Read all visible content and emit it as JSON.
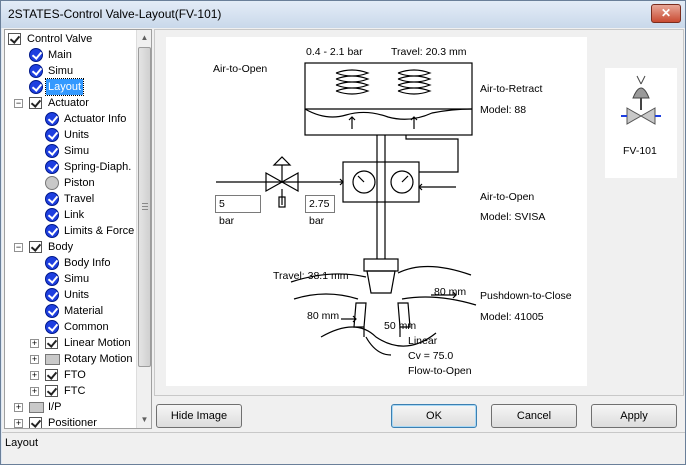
{
  "window": {
    "title": "2STATES-Control Valve-Layout(FV-101)",
    "close_label": "✕"
  },
  "tree": {
    "items": [
      {
        "label": "Control Valve",
        "icon": "check",
        "indent": 0,
        "expander": "",
        "selected": false
      },
      {
        "label": "Main",
        "icon": "valid",
        "indent": 1,
        "expander": "",
        "selected": false
      },
      {
        "label": "Simu",
        "icon": "valid",
        "indent": 1,
        "expander": "",
        "selected": false
      },
      {
        "label": "Layout",
        "icon": "valid",
        "indent": 1,
        "expander": "",
        "selected": true
      },
      {
        "label": "Actuator",
        "icon": "check",
        "indent": 1,
        "expander": "−",
        "selected": false
      },
      {
        "label": "Actuator Info",
        "icon": "valid",
        "indent": 2,
        "expander": "",
        "selected": false
      },
      {
        "label": "Units",
        "icon": "valid",
        "indent": 2,
        "expander": "",
        "selected": false
      },
      {
        "label": "Simu",
        "icon": "valid",
        "indent": 2,
        "expander": "",
        "selected": false
      },
      {
        "label": "Spring-Diaph.",
        "icon": "valid",
        "indent": 2,
        "expander": "",
        "selected": false
      },
      {
        "label": "Piston",
        "icon": "grey",
        "indent": 2,
        "expander": "",
        "selected": false
      },
      {
        "label": "Travel",
        "icon": "valid",
        "indent": 2,
        "expander": "",
        "selected": false
      },
      {
        "label": "Link",
        "icon": "valid",
        "indent": 2,
        "expander": "",
        "selected": false
      },
      {
        "label": "Limits & Force",
        "icon": "valid",
        "indent": 2,
        "expander": "",
        "selected": false
      },
      {
        "label": "Body",
        "icon": "check",
        "indent": 1,
        "expander": "−",
        "selected": false
      },
      {
        "label": "Body Info",
        "icon": "valid",
        "indent": 2,
        "expander": "",
        "selected": false
      },
      {
        "label": "Simu",
        "icon": "valid",
        "indent": 2,
        "expander": "",
        "selected": false
      },
      {
        "label": "Units",
        "icon": "valid",
        "indent": 2,
        "expander": "",
        "selected": false
      },
      {
        "label": "Material",
        "icon": "valid",
        "indent": 2,
        "expander": "",
        "selected": false
      },
      {
        "label": "Common",
        "icon": "valid",
        "indent": 2,
        "expander": "",
        "selected": false
      },
      {
        "label": "Linear Motion",
        "icon": "check",
        "indent": 2,
        "expander": "+",
        "selected": false
      },
      {
        "label": "Rotary Motion",
        "icon": "folder",
        "indent": 2,
        "expander": "+",
        "selected": false
      },
      {
        "label": "FTO",
        "icon": "check",
        "indent": 2,
        "expander": "+",
        "selected": false
      },
      {
        "label": "FTC",
        "icon": "check",
        "indent": 2,
        "expander": "+",
        "selected": false
      },
      {
        "label": "I/P",
        "icon": "folder",
        "indent": 1,
        "expander": "+",
        "selected": false
      },
      {
        "label": "Positioner",
        "icon": "check",
        "indent": 1,
        "expander": "+",
        "selected": false
      }
    ]
  },
  "diagram": {
    "air_to_open_top": "Air-to-Open",
    "pressure_range": "0.4 - 2.1 bar",
    "travel_actuator": "Travel: 20.3 mm",
    "actuator_action": "Air-to-Retract",
    "actuator_model": "Model: 88",
    "supply_value": "5",
    "supply_unit": "bar",
    "output_value": "2.75",
    "output_unit": "bar",
    "positioner_action": "Air-to-Open",
    "positioner_model": "Model: SVISA",
    "travel_body": "Travel: 38.1 mm",
    "body_action": "Pushdown-to-Close",
    "body_model": "Model: 41005",
    "dim_80_right": "80 mm",
    "dim_80_left": "80 mm",
    "dim_50": "50 mm",
    "char_linear": "Linear",
    "cv": "Cv = 75.0",
    "flow": "Flow-to-Open"
  },
  "thumbnail": {
    "tag": "FV-101"
  },
  "buttons": {
    "hide_image": "Hide Image",
    "ok": "OK",
    "cancel": "Cancel",
    "apply": "Apply"
  },
  "status": {
    "text": "Layout"
  }
}
